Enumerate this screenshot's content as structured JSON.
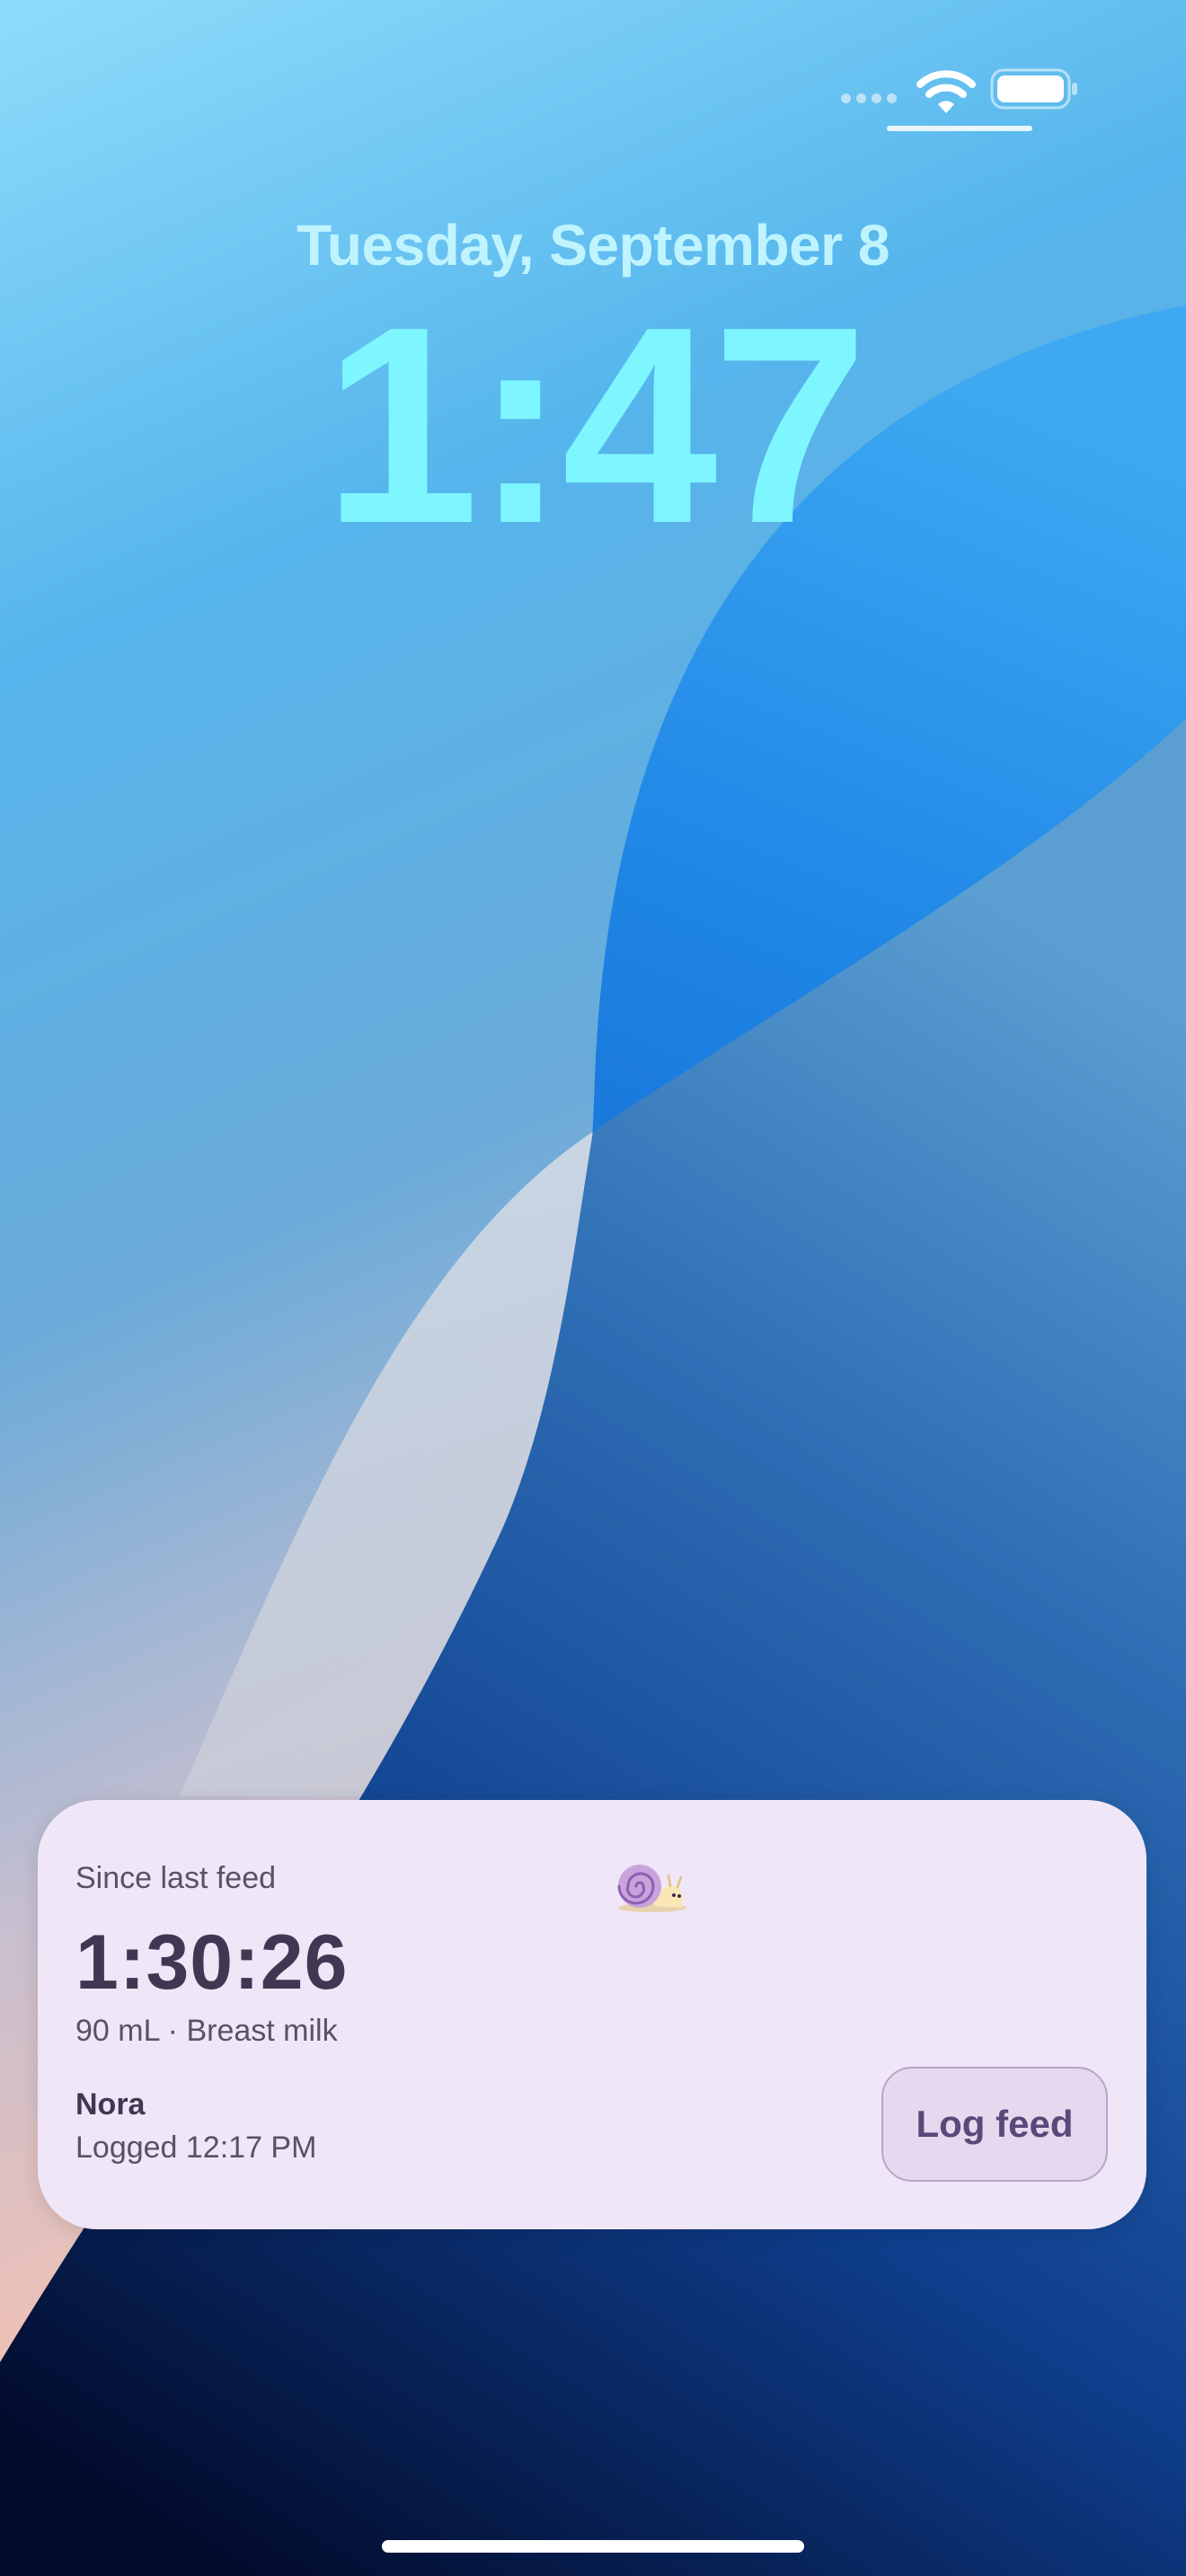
{
  "lock_screen": {
    "date": "Tuesday, September 8",
    "time": "1:47"
  },
  "status_bar": {
    "icons": [
      "signal-dots-icon",
      "wifi-icon",
      "battery-icon"
    ]
  },
  "widget": {
    "since_label": "Since last feed",
    "elapsed": "1:30:26",
    "feed_detail": "90 mL · Breast milk",
    "baby_name": "Nora",
    "logged_at": "Logged 12:17 PM",
    "log_button_label": "Log feed",
    "icon": "snail-icon"
  },
  "colors": {
    "time": "#7ef6ff",
    "date": "#bff4ff",
    "widget_background": "#efe6f7",
    "button_background": "#e7d8ef",
    "button_text": "#594878"
  }
}
